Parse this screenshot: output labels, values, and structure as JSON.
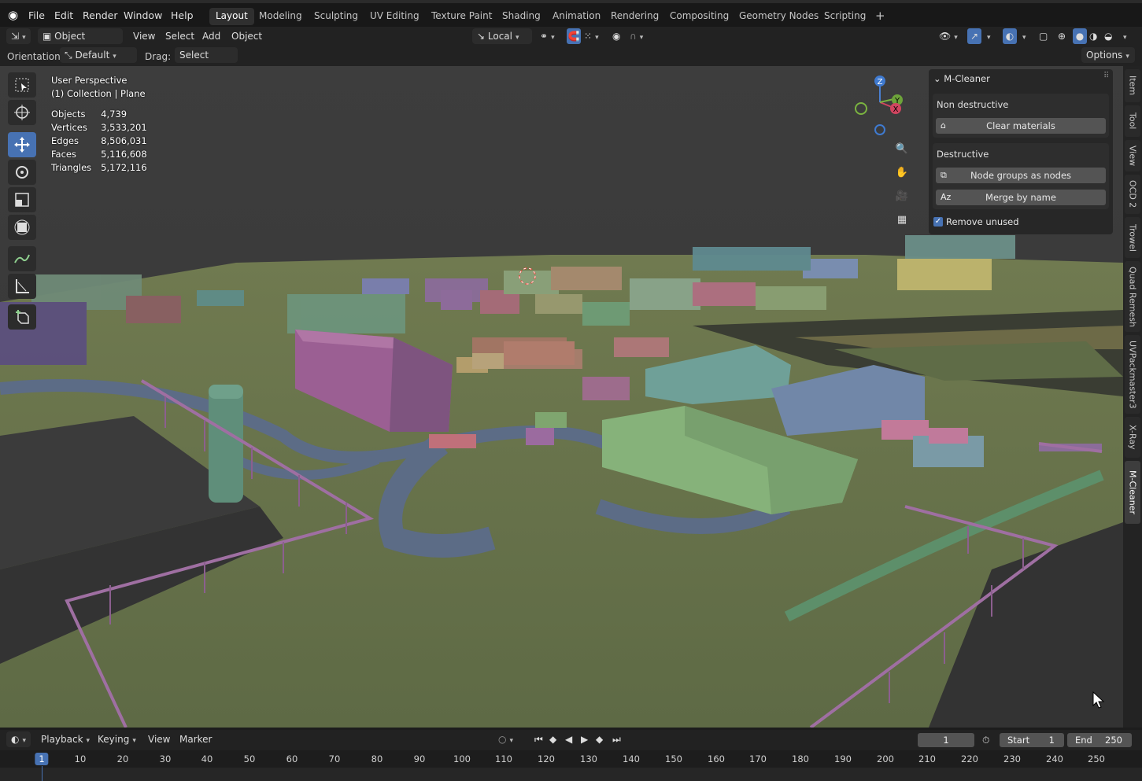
{
  "menus": [
    "File",
    "Edit",
    "Render",
    "Window",
    "Help"
  ],
  "workspaces": [
    "Layout",
    "Modeling",
    "Sculpting",
    "UV Editing",
    "Texture Paint",
    "Shading",
    "Animation",
    "Rendering",
    "Compositing",
    "Geometry Nodes",
    "Scripting"
  ],
  "active_workspace": "Layout",
  "header": {
    "mode": "Object Mode",
    "menus": [
      "View",
      "Select",
      "Add",
      "Object"
    ],
    "transform_orientation": "Local"
  },
  "tool_settings": {
    "orientation_label": "Orientation:",
    "orientation_value": "Default",
    "drag_label": "Drag:",
    "drag_value": "Select Box",
    "options": "Options"
  },
  "viewport": {
    "perspective": "User Perspective",
    "collection": "(1) Collection | Plane",
    "stats": [
      {
        "label": "Objects",
        "value": "4,739"
      },
      {
        "label": "Vertices",
        "value": "3,533,201"
      },
      {
        "label": "Edges",
        "value": "8,506,031"
      },
      {
        "label": "Faces",
        "value": "5,116,608"
      },
      {
        "label": "Triangles",
        "value": "5,172,116"
      }
    ],
    "gizmo": {
      "z": "Z",
      "y": "Y",
      "x": "X"
    }
  },
  "npanel": {
    "title": "M-Cleaner",
    "non_destructive_label": "Non destructive",
    "clear_materials": "Clear materials",
    "destructive_label": "Destructive",
    "node_groups": "Node groups as nodes",
    "merge_by_name": "Merge by name",
    "remove_unused": "Remove unused",
    "remove_unused_checked": true
  },
  "side_tabs": [
    "Item",
    "Tool",
    "View",
    "OCD 2",
    "Trowel",
    "Quad Remesh",
    "UVPackmaster3",
    "X-Ray",
    "M-Cleaner"
  ],
  "active_side_tab": "M-Cleaner",
  "timeline": {
    "menus": [
      "Playback",
      "Keying",
      "View",
      "Marker"
    ],
    "current_frame": "1",
    "start_label": "Start",
    "start": "1",
    "end_label": "End",
    "end": "250",
    "ticks": [
      "1",
      "10",
      "20",
      "30",
      "40",
      "50",
      "60",
      "70",
      "80",
      "90",
      "100",
      "110",
      "120",
      "130",
      "140",
      "150",
      "160",
      "170",
      "180",
      "190",
      "200",
      "210",
      "220",
      "230",
      "240",
      "250"
    ]
  }
}
